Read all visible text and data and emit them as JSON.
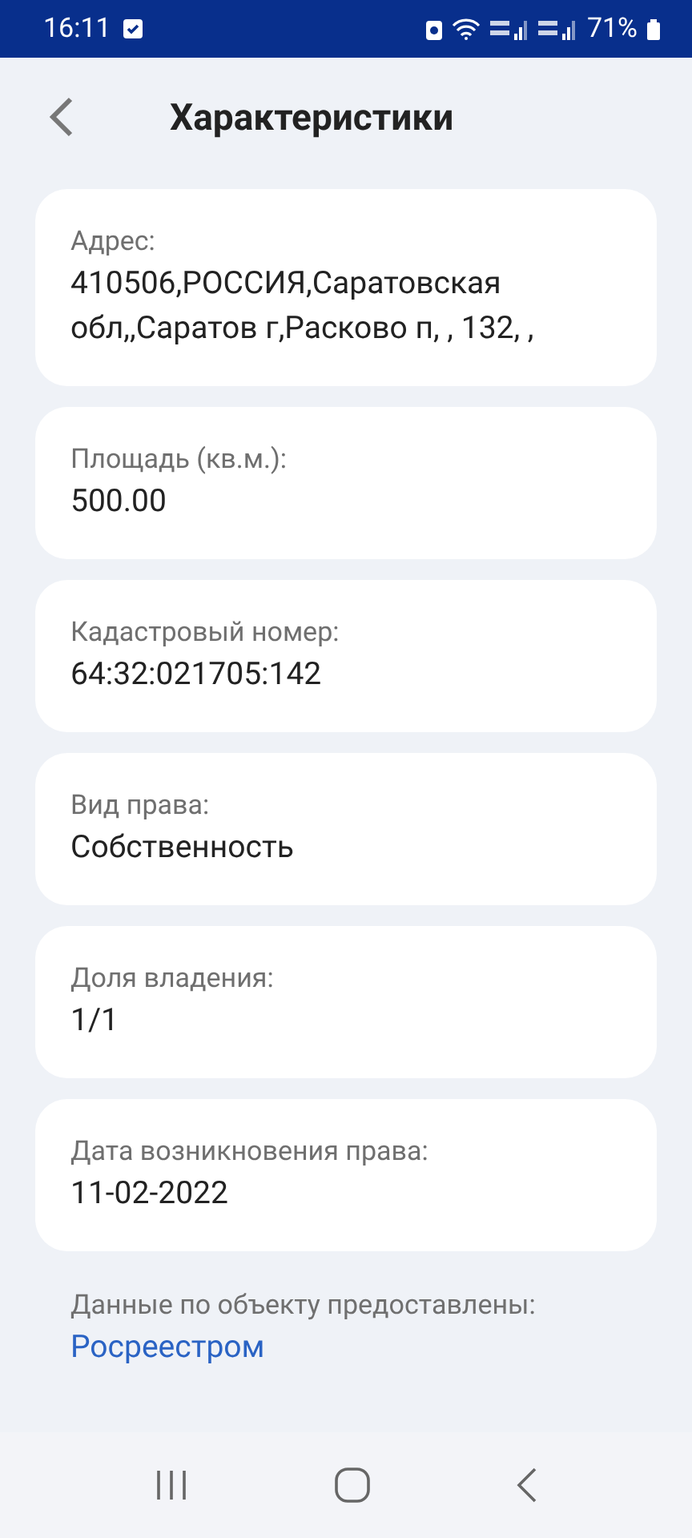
{
  "status_bar": {
    "time": "16:11",
    "battery": "71%"
  },
  "header": {
    "title": "Характеристики"
  },
  "fields": [
    {
      "label": "Адрес:",
      "value": "410506,РОССИЯ,Саратовская обл,,Саратов г,Расково п, , 132, ,"
    },
    {
      "label": "Площадь (кв.м.):",
      "value": "500.00"
    },
    {
      "label": "Кадастровый номер:",
      "value": "64:32:021705:142"
    },
    {
      "label": "Вид права:",
      "value": "Собственность"
    },
    {
      "label": "Доля владения:",
      "value": "1/1"
    },
    {
      "label": "Дата возникновения права:",
      "value": "11-02-2022"
    }
  ],
  "source": {
    "text": "Данные по объекту предоставлены:",
    "link": "Росреестром"
  }
}
